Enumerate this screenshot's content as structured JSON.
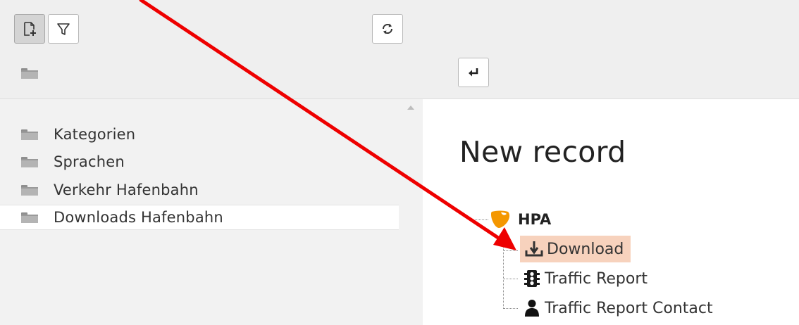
{
  "toolbar": {
    "buttons": [
      {
        "icon": "new-page-icon",
        "active": true
      },
      {
        "icon": "filter-icon",
        "active": false
      },
      {
        "icon": "refresh-icon",
        "active": false
      },
      {
        "icon": "return-icon",
        "active": false
      }
    ],
    "root_icon": "folder-icon"
  },
  "tree": {
    "items": [
      {
        "label": "Kategorien",
        "icon": "folder-icon"
      },
      {
        "label": "Sprachen",
        "icon": "folder-icon"
      },
      {
        "label": "Verkehr Hafenbahn",
        "icon": "folder-icon"
      },
      {
        "label": "Downloads Hafenbahn",
        "icon": "folder-icon",
        "selected": true
      }
    ]
  },
  "content": {
    "title": "New record",
    "root": {
      "label": "HPA",
      "icon": "typo3-logo-icon"
    },
    "records": [
      {
        "label": "Download",
        "icon": "download-icon",
        "highlighted": true
      },
      {
        "label": "Traffic Report",
        "icon": "traffic-light-icon"
      },
      {
        "label": "Traffic Report Contact",
        "icon": "person-icon"
      }
    ]
  },
  "colors": {
    "annotation_arrow": "#ee0000",
    "highlight": "#f7d2bd",
    "typo3_orange": "#f49700"
  }
}
